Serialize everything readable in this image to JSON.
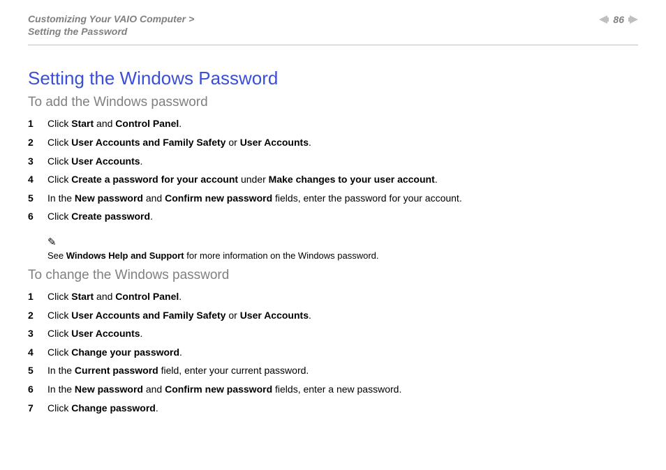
{
  "breadcrumb": {
    "line1": "Customizing Your VAIO Computer",
    "sep": ">",
    "line2": "Setting the Password"
  },
  "page_number": "86",
  "title": "Setting the Windows Password",
  "add": {
    "heading": "To add the Windows password",
    "steps": [
      {
        "n": "1",
        "pre": "Click ",
        "b1": "Start",
        "mid": " and ",
        "b2": "Control Panel",
        "post": "."
      },
      {
        "n": "2",
        "pre": "Click ",
        "b1": "User Accounts and Family Safety",
        "mid": " or ",
        "b2": "User Accounts",
        "post": "."
      },
      {
        "n": "3",
        "pre": "Click ",
        "b1": "User Accounts",
        "post": "."
      },
      {
        "n": "4",
        "pre": "Click ",
        "b1": "Create a password for your account",
        "mid": " under ",
        "b2": "Make changes to your user account",
        "post": "."
      },
      {
        "n": "5",
        "pre": "In the ",
        "b1": "New password",
        "mid": " and ",
        "b2": "Confirm new password",
        "post": " fields, enter the password for your account."
      },
      {
        "n": "6",
        "pre": "Click ",
        "b1": "Create password",
        "post": "."
      }
    ]
  },
  "note": {
    "mark": "✎",
    "pre": "See ",
    "b": "Windows Help and Support",
    "post": " for more information on the Windows password."
  },
  "change": {
    "heading": "To change the Windows password",
    "steps": [
      {
        "n": "1",
        "pre": "Click ",
        "b1": "Start",
        "mid": " and ",
        "b2": "Control Panel",
        "post": "."
      },
      {
        "n": "2",
        "pre": "Click ",
        "b1": "User Accounts and Family Safety",
        "mid": " or ",
        "b2": "User Accounts",
        "post": "."
      },
      {
        "n": "3",
        "pre": "Click ",
        "b1": "User Accounts",
        "post": "."
      },
      {
        "n": "4",
        "pre": "Click ",
        "b1": "Change your password",
        "post": "."
      },
      {
        "n": "5",
        "pre": "In the ",
        "b1": "Current password",
        "post": " field, enter your current password."
      },
      {
        "n": "6",
        "pre": "In the ",
        "b1": "New password",
        "mid": " and ",
        "b2": "Confirm new password",
        "post": " fields, enter a new password."
      },
      {
        "n": "7",
        "pre": "Click ",
        "b1": "Change password",
        "post": "."
      }
    ]
  }
}
